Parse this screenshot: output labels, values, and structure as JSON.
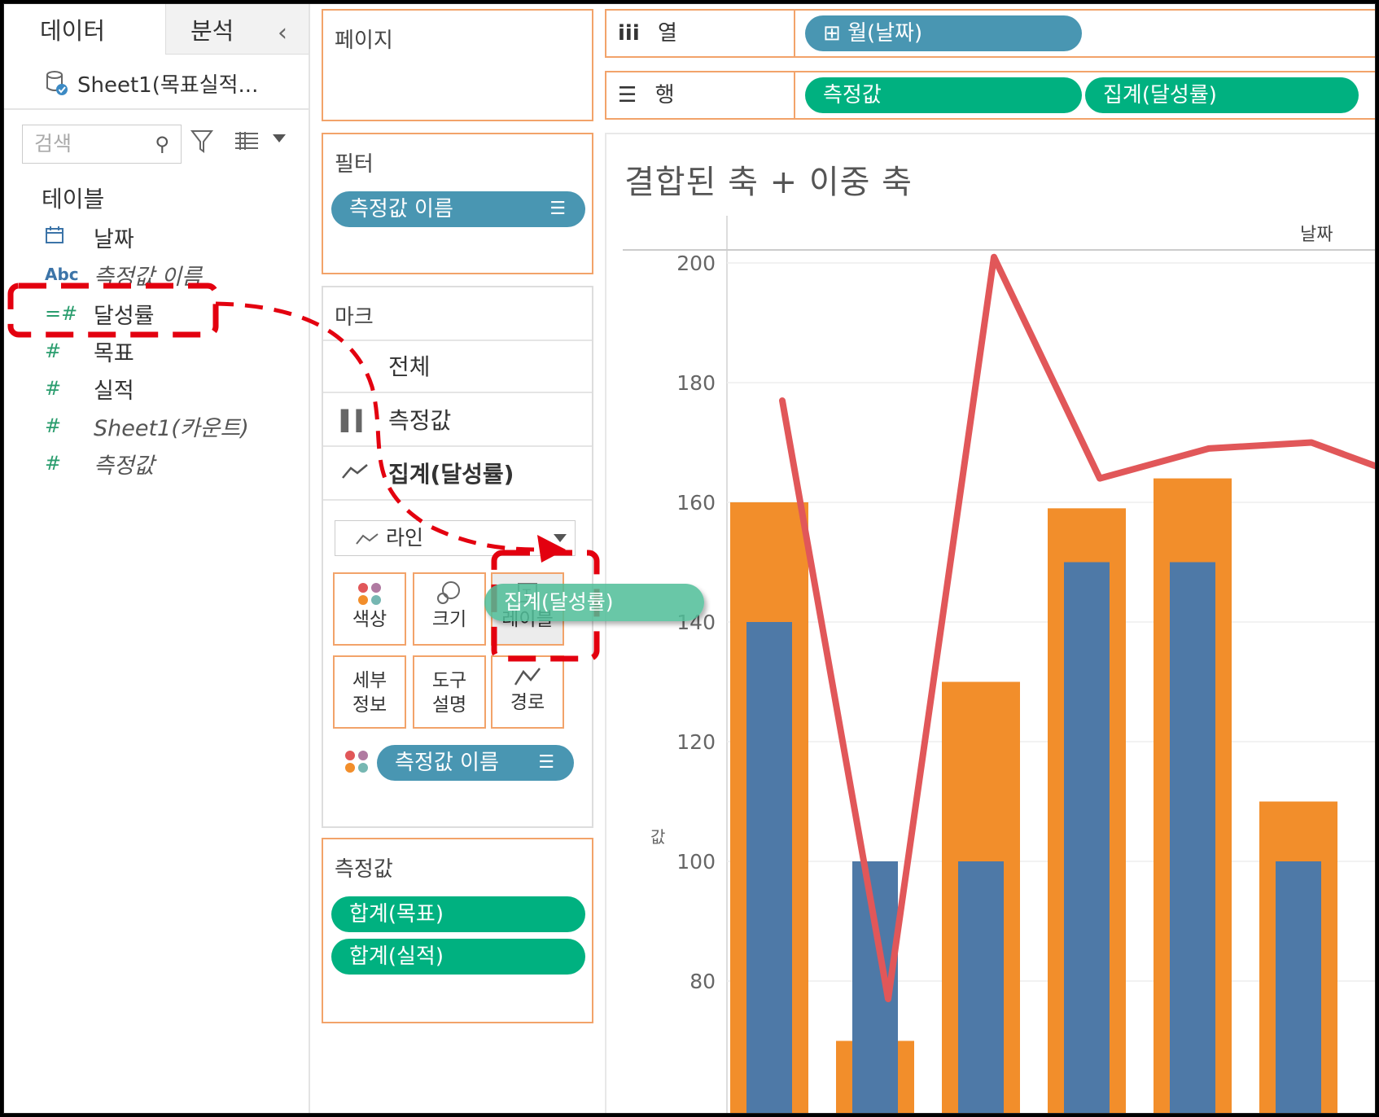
{
  "data_pane": {
    "tabs": [
      "데이터",
      "분석"
    ],
    "source_name": "Sheet1(목표실적...",
    "search_placeholder": "검색",
    "section_title": "테이블",
    "fields": [
      {
        "icon": "calendar-icon",
        "name": "날짜",
        "italic": false
      },
      {
        "icon": "abc-icon",
        "icon_text": "Abc",
        "name": "측정값 이름",
        "italic": true
      },
      {
        "icon": "calculated-measure-icon",
        "icon_text": "=#",
        "name": "달성률",
        "italic": false
      },
      {
        "icon": "measure-icon",
        "icon_text": "#",
        "name": "목표",
        "italic": false
      },
      {
        "icon": "measure-icon",
        "icon_text": "#",
        "name": "실적",
        "italic": false
      },
      {
        "icon": "measure-icon",
        "icon_text": "#",
        "name": "Sheet1(카운트)",
        "italic": true
      },
      {
        "icon": "measure-icon",
        "icon_text": "#",
        "name": "측정값",
        "italic": true
      }
    ]
  },
  "pages_card": {
    "title": "페이지"
  },
  "filters_card": {
    "title": "필터",
    "pill": "측정값 이름"
  },
  "marks_card": {
    "title": "마크",
    "rows": [
      "전체",
      "측정값",
      "집계(달성률)"
    ],
    "mark_type": "라인",
    "buttons": [
      "색상",
      "크기",
      "레이블",
      "세부\n정보",
      "도구\n설명",
      "경로"
    ],
    "buttons_split": {
      "detail": [
        "세부",
        "정보"
      ],
      "tooltip": [
        "도구",
        "설명"
      ]
    },
    "color_pill": "측정값 이름"
  },
  "measure_values_card": {
    "title": "측정값",
    "pills": [
      "합계(목표)",
      "합계(실적)"
    ]
  },
  "shelves": {
    "columns_label": "열",
    "columns_pill": "월(날짜)",
    "rows_label": "행",
    "rows_pills": [
      "측정값",
      "집계(달성률)"
    ]
  },
  "view": {
    "title": "결합된 축 + 이중 축",
    "column_header": "날짜",
    "axis_label": "값"
  },
  "drag": {
    "pill": "집계(달성률)"
  },
  "colors": {
    "target": "#f28e2b",
    "actual": "#4e79a7",
    "rate": "#e15759",
    "accent": "#f2a36a"
  },
  "chart_data": {
    "type": "bar",
    "title": "결합된 축 + 이중 축",
    "ylabel": "값",
    "yticks": [
      80,
      100,
      120,
      140,
      160,
      180,
      200
    ],
    "grid": true,
    "series": [
      {
        "name": "합계(목표)",
        "type": "bar",
        "values": [
          160,
          70,
          130,
          159,
          164,
          110
        ]
      },
      {
        "name": "합계(실적)",
        "type": "bar",
        "values": [
          140,
          100,
          100,
          150,
          150,
          100
        ]
      },
      {
        "name": "집계(달성률)",
        "type": "line",
        "values": [
          177,
          77,
          201,
          164,
          169,
          170,
          166
        ]
      }
    ]
  }
}
